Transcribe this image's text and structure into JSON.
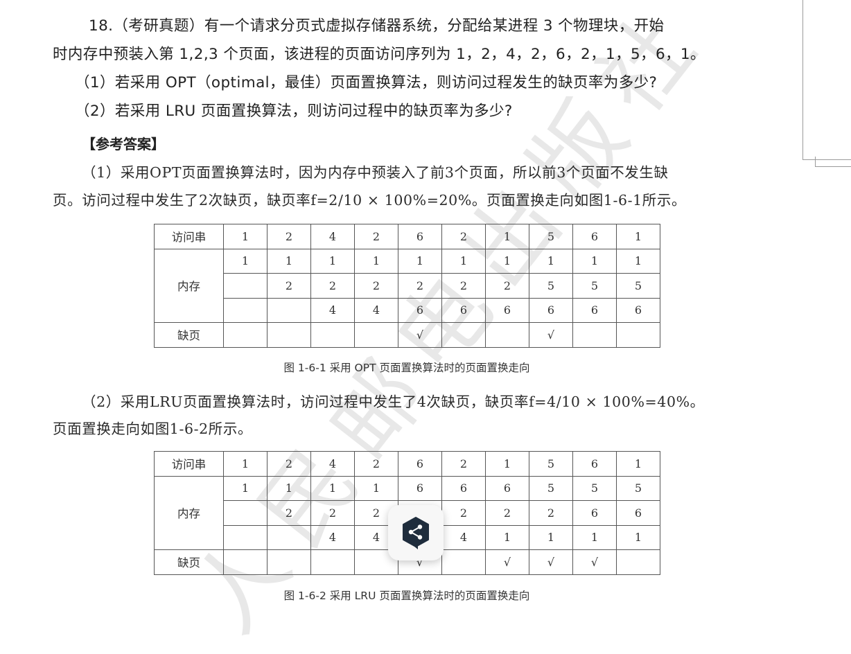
{
  "question": {
    "line1": "18.（考研真题）有一个请求分页式虚拟存储器系统，分配给某进程 3 个物理块，开始",
    "line2": "时内存中预装入第 1,2,3 个页面，该进程的页面访问序列为 1，2，4，2，6，2，1，5，6，1。",
    "part1": "（1）若采用 OPT（optimal，最佳）页面置换算法，则访问过程发生的缺页率为多少?",
    "part2": "（2）若采用 LRU 页面置换算法，则访问过程中的缺页率为多少?"
  },
  "answer": {
    "heading": "【参考答案】",
    "opt_line1": "（1）采用OPT页面置换算法时，因为内存中预装入了前3个页面，所以前3个页面不发生缺",
    "opt_line2": "页。访问过程中发生了2次缺页，缺页率f=2/10 × 100%=20%。页面置换走向如图1-6-1所示。",
    "lru_line1": "（2）采用LRU页面置换算法时，访问过程中发生了4次缺页，缺页率f=4/10 × 100%=40%。",
    "lru_line2": "页面置换走向如图1-6-2所示。"
  },
  "table_labels": {
    "access": "访问串",
    "memory": "内存",
    "fault": "缺页"
  },
  "opt_table": {
    "caption": "图 1-6-1    采用 OPT 页面置换算法时的页面置换走向",
    "access": [
      "1",
      "2",
      "4",
      "2",
      "6",
      "2",
      "1",
      "5",
      "6",
      "1"
    ],
    "frame1": [
      "1",
      "1",
      "1",
      "1",
      "1",
      "1",
      "1",
      "1",
      "1",
      "1"
    ],
    "frame2": [
      "",
      "2",
      "2",
      "2",
      "2",
      "2",
      "2",
      "5",
      "5",
      "5"
    ],
    "frame3": [
      "",
      "",
      "4",
      "4",
      "6",
      "6",
      "6",
      "6",
      "6",
      "6"
    ],
    "fault": [
      "",
      "",
      "",
      "",
      "√",
      "",
      "",
      "√",
      "",
      ""
    ]
  },
  "lru_table": {
    "caption": "图 1-6-2    采用 LRU 页面置换算法时的页面置换走向",
    "access": [
      "1",
      "2",
      "4",
      "2",
      "6",
      "2",
      "1",
      "5",
      "6",
      "1"
    ],
    "frame1": [
      "1",
      "1",
      "1",
      "1",
      "6",
      "6",
      "6",
      "5",
      "5",
      "5"
    ],
    "frame2": [
      "",
      "2",
      "2",
      "2",
      "2",
      "2",
      "2",
      "2",
      "6",
      "6"
    ],
    "frame3": [
      "",
      "",
      "4",
      "4",
      "4",
      "4",
      "1",
      "1",
      "1",
      "1"
    ],
    "fault": [
      "",
      "",
      "",
      "",
      "√",
      "",
      "√",
      "√",
      "√",
      ""
    ]
  },
  "watermark": "人民邮电出版社",
  "share_button": {
    "icon": "share-icon",
    "color": "#1f2d3d"
  }
}
